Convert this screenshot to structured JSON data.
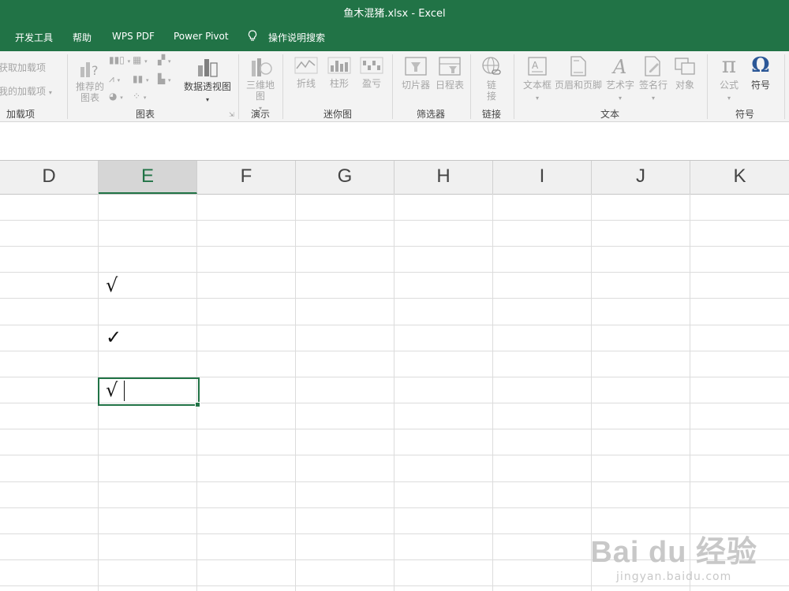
{
  "window": {
    "title": "鱼木混猪.xlsx  -  Excel"
  },
  "tabs": [
    "开发工具",
    "帮助",
    "WPS PDF",
    "Power Pivot",
    "操作说明搜索"
  ],
  "ribbon": {
    "addins": {
      "get": "获取加载项",
      "mine": "我的加载项",
      "label": "加载项"
    },
    "charts": {
      "recommended": "推荐的图表",
      "pivot": "数据透视图",
      "label": "图表"
    },
    "tours": {
      "map3d": "三维地图",
      "label": "演示"
    },
    "sparklines": {
      "line": "折线",
      "column": "柱形",
      "winloss": "盈亏",
      "label": "迷你图"
    },
    "filters": {
      "slicer": "切片器",
      "timeline": "日程表",
      "label": "筛选器"
    },
    "links": {
      "link": "链接",
      "label": "链接"
    },
    "text": {
      "textbox": "文本框",
      "headerfooter": "页眉和页脚",
      "wordart": "艺术字",
      "signature": "签名行",
      "object": "对象",
      "label": "文本"
    },
    "symbols": {
      "equation": "公式",
      "symbol": "符号",
      "label": "符号"
    }
  },
  "columns": [
    "D",
    "E",
    "F",
    "G",
    "H",
    "I",
    "J",
    "K"
  ],
  "active_column": "E",
  "cells": [
    {
      "col": "E",
      "row_index": 3,
      "value": "√"
    },
    {
      "col": "E",
      "row_index": 5,
      "value": "✓"
    },
    {
      "col": "E",
      "row_index": 7,
      "value": "√"
    }
  ],
  "watermark": {
    "main": "Bai du 经验",
    "sub": "jingyan.baidu.com"
  },
  "colors": {
    "brand": "#217346",
    "ribbon_bg": "#f3f3f3",
    "disabled": "#a6a6a6"
  }
}
